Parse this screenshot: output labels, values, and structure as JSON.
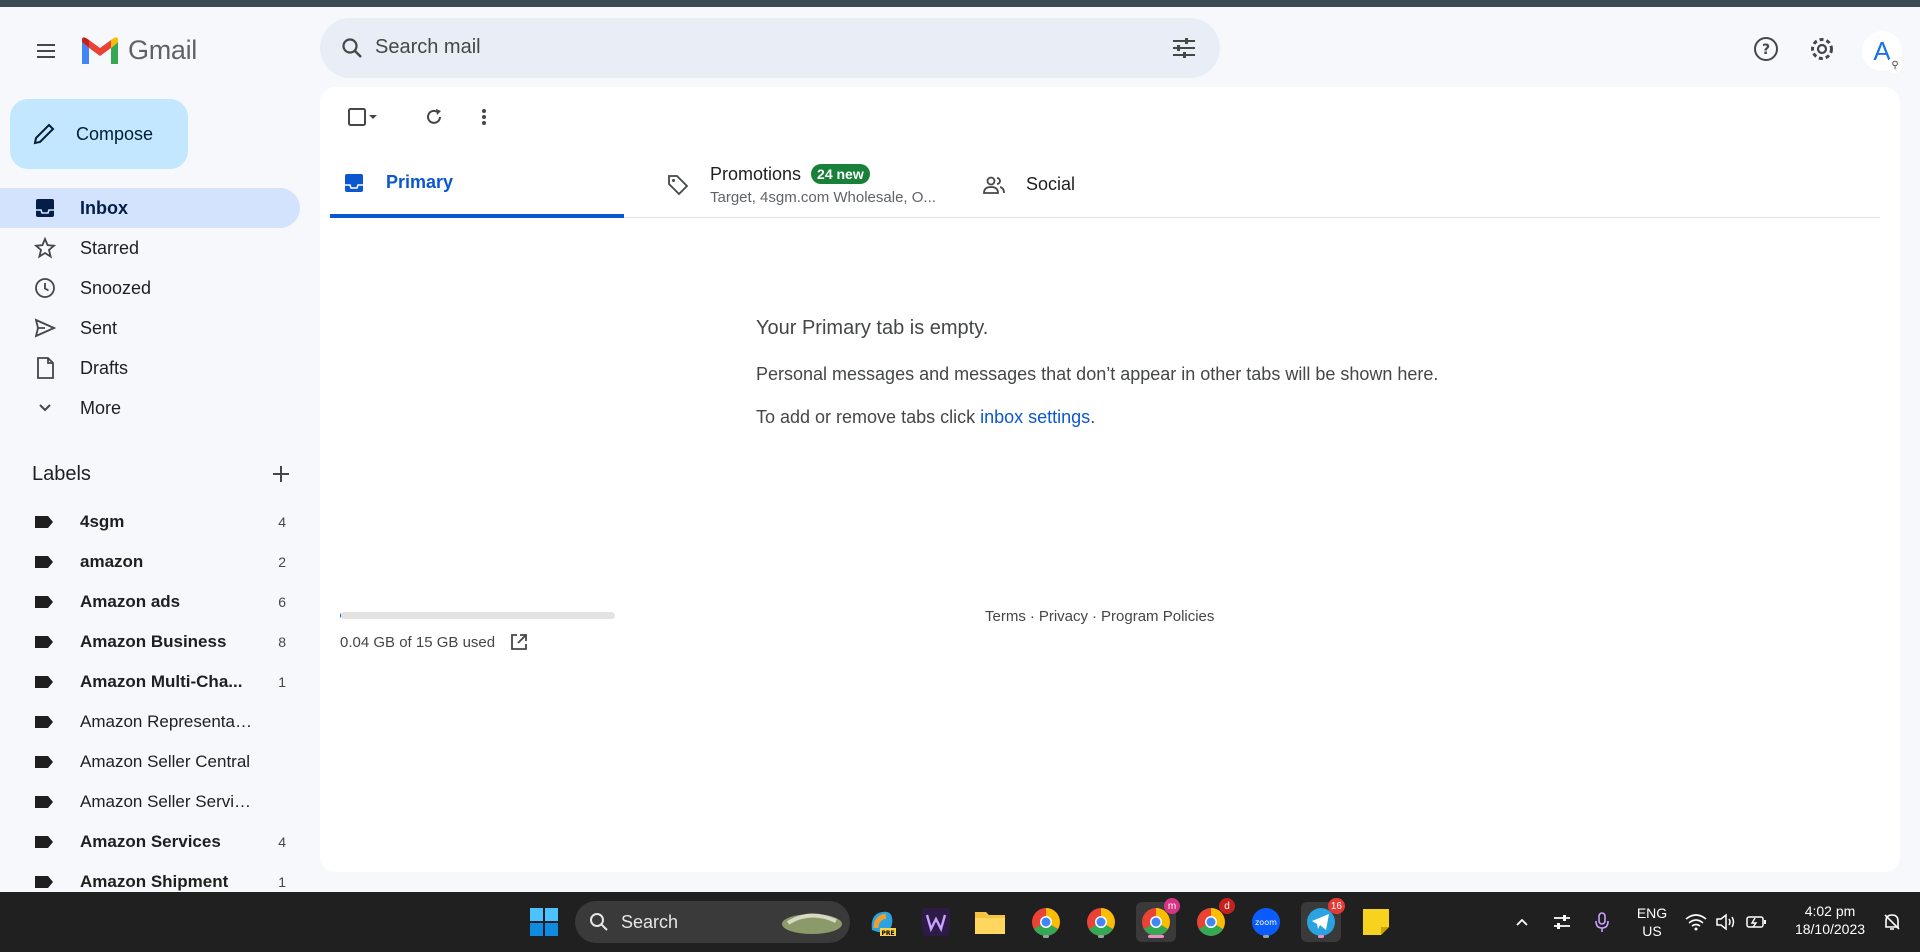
{
  "app": {
    "name": "Gmail"
  },
  "search": {
    "placeholder": "Search mail"
  },
  "header": {
    "avatar_letter": "A",
    "avatar_badge": "⚲"
  },
  "compose": {
    "label": "Compose"
  },
  "nav": [
    {
      "label": "Inbox",
      "icon": "inbox-icon",
      "active": true
    },
    {
      "label": "Starred",
      "icon": "star-icon"
    },
    {
      "label": "Snoozed",
      "icon": "clock-icon"
    },
    {
      "label": "Sent",
      "icon": "send-icon"
    },
    {
      "label": "Drafts",
      "icon": "draft-icon"
    },
    {
      "label": "More",
      "icon": "chevron-down-icon"
    }
  ],
  "labels": {
    "title": "Labels",
    "items": [
      {
        "name": "4sgm",
        "count": "4",
        "bold": true
      },
      {
        "name": "amazon",
        "count": "2",
        "bold": true
      },
      {
        "name": "Amazon ads",
        "count": "6",
        "bold": true
      },
      {
        "name": "Amazon Business",
        "count": "8",
        "bold": true
      },
      {
        "name": "Amazon Multi-Cha...",
        "count": "1",
        "bold": true
      },
      {
        "name": "Amazon Representative",
        "count": "",
        "bold": false
      },
      {
        "name": "Amazon Seller Central",
        "count": "",
        "bold": false
      },
      {
        "name": "Amazon Seller Services",
        "count": "",
        "bold": false
      },
      {
        "name": "Amazon Services",
        "count": "4",
        "bold": true
      },
      {
        "name": "Amazon Shipment",
        "count": "1",
        "bold": true
      }
    ]
  },
  "tabs": {
    "primary": "Primary",
    "promotions": "Promotions",
    "promotions_badge": "24 new",
    "promotions_sub": "Target, 4sgm.com Wholesale, O...",
    "social": "Social"
  },
  "empty": {
    "title": "Your Primary tab is empty.",
    "message": "Personal messages and messages that don’t appear in other tabs will be shown here.",
    "settings_prefix": "To add or remove tabs click ",
    "settings_link": "inbox settings",
    "settings_suffix": "."
  },
  "storage": {
    "text": "0.04 GB of 15 GB used",
    "fraction": 0.003
  },
  "footer": {
    "terms": "Terms",
    "privacy": "Privacy",
    "policies": "Program Policies",
    "sep": "·"
  },
  "taskbar": {
    "search": "Search",
    "lang_top": "ENG",
    "lang_bottom": "US",
    "time": "4:02 pm",
    "date": "18/10/2023",
    "chrome_badge_1": "m",
    "chrome_badge_2": "d",
    "telegram_badge": "16"
  },
  "colors": {
    "accent": "#0b57d0",
    "compose_bg": "#c2e7ff",
    "nav_active_bg": "#d3e3fd",
    "promo_badge": "#188038",
    "bg": "#f6f8fc"
  }
}
